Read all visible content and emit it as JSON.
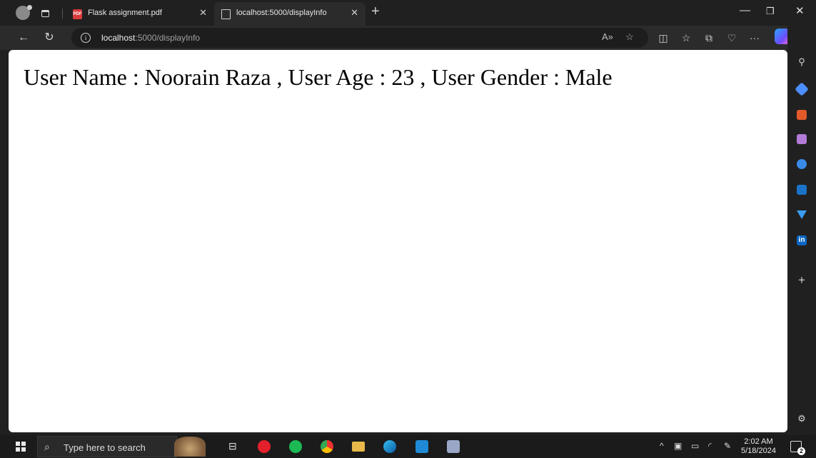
{
  "browser": {
    "tabs": [
      {
        "title": "Flask assignment.pdf",
        "active": false,
        "favicon": "pdf-icon"
      },
      {
        "title": "localhost:5000/displayInfo",
        "active": true,
        "favicon": "page-icon"
      }
    ],
    "address_bar": {
      "host": "localhost",
      "path": ":5000/displayInfo"
    }
  },
  "page": {
    "content": "User Name : Noorain Raza , User Age : 23 , User Gender : Male"
  },
  "taskbar": {
    "search_placeholder": "Type here to search",
    "time": "2:02 AM",
    "date": "5/18/2024",
    "notification_count": "2"
  },
  "colors": {
    "accent": "#0078d4",
    "chrome_dark": "#202020",
    "toolbar": "#2b2b2b"
  }
}
